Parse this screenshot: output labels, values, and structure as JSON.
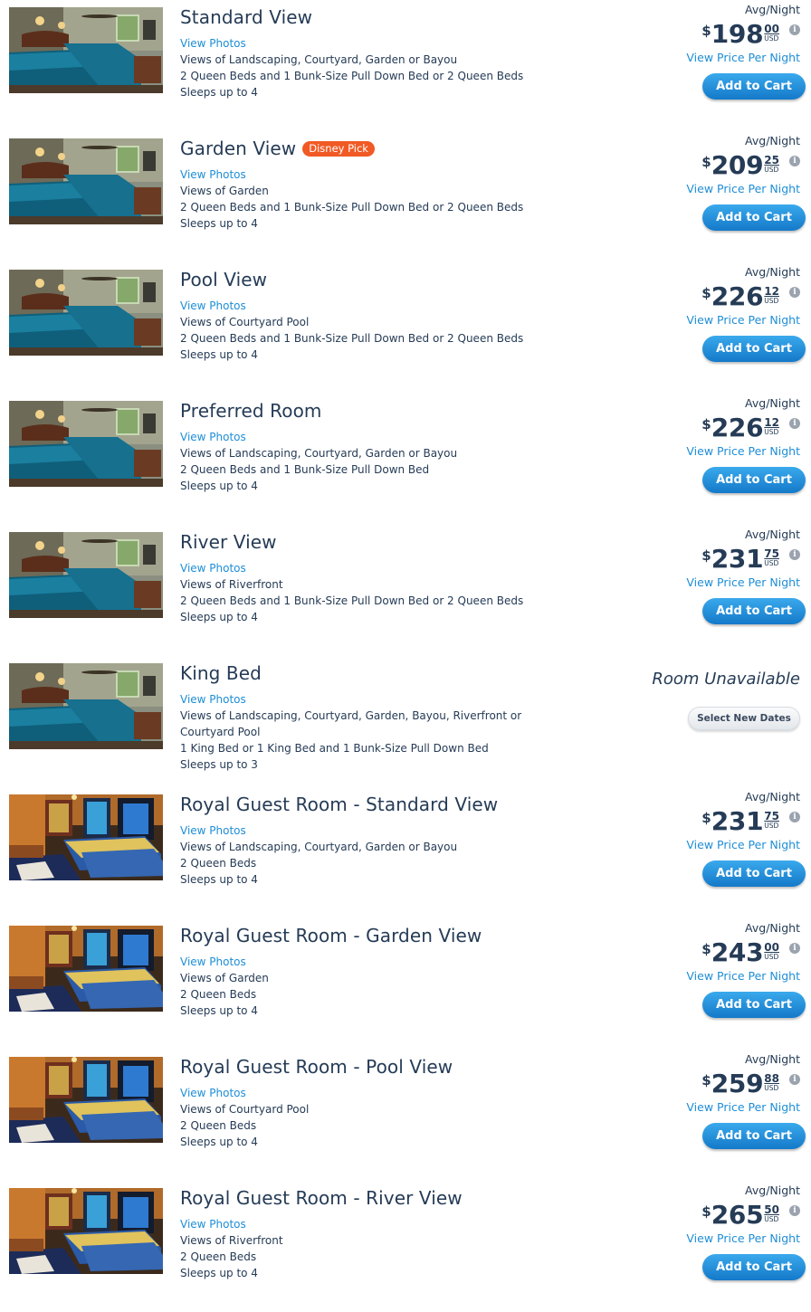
{
  "rooms": [
    {
      "title": "Standard View",
      "badge": "",
      "view_photos": "View Photos",
      "lines": [
        "Views of Landscaping, Courtyard, Garden or Bayou",
        "2 Queen Beds and 1 Bunk-Size Pull Down Bed or 2 Queen Beds",
        "Sleeps up to 4"
      ],
      "available": true,
      "avg_label": "Avg/Night",
      "currency_symbol": "$",
      "price_whole": "198",
      "price_cents": "00",
      "currency": "USD",
      "info_icon": "i",
      "price_per_night": "View Price Per Night",
      "add_to_cart": "Add to Cart",
      "image": "room-photo"
    },
    {
      "title": "Garden View",
      "badge": "Disney Pick",
      "view_photos": "View Photos",
      "lines": [
        "Views of Garden",
        "2 Queen Beds and 1 Bunk-Size Pull Down Bed or 2 Queen Beds",
        "Sleeps up to 4"
      ],
      "available": true,
      "avg_label": "Avg/Night",
      "currency_symbol": "$",
      "price_whole": "209",
      "price_cents": "25",
      "currency": "USD",
      "info_icon": "i",
      "price_per_night": "View Price Per Night",
      "add_to_cart": "Add to Cart",
      "image": "room-photo"
    },
    {
      "title": "Pool View",
      "badge": "",
      "view_photos": "View Photos",
      "lines": [
        "Views of Courtyard Pool",
        "2 Queen Beds and 1 Bunk-Size Pull Down Bed or 2 Queen Beds",
        "Sleeps up to 4"
      ],
      "available": true,
      "avg_label": "Avg/Night",
      "currency_symbol": "$",
      "price_whole": "226",
      "price_cents": "12",
      "currency": "USD",
      "info_icon": "i",
      "price_per_night": "View Price Per Night",
      "add_to_cart": "Add to Cart",
      "image": "room-photo"
    },
    {
      "title": "Preferred Room",
      "badge": "",
      "view_photos": "View Photos",
      "lines": [
        "Views of Landscaping, Courtyard, Garden or Bayou",
        "2 Queen Beds and 1 Bunk-Size Pull Down Bed",
        "Sleeps up to 4"
      ],
      "available": true,
      "avg_label": "Avg/Night",
      "currency_symbol": "$",
      "price_whole": "226",
      "price_cents": "12",
      "currency": "USD",
      "info_icon": "i",
      "price_per_night": "View Price Per Night",
      "add_to_cart": "Add to Cart",
      "image": "room-photo"
    },
    {
      "title": "River View",
      "badge": "",
      "view_photos": "View Photos",
      "lines": [
        "Views of Riverfront",
        "2 Queen Beds and 1 Bunk-Size Pull Down Bed or 2 Queen Beds",
        "Sleeps up to 4"
      ],
      "available": true,
      "avg_label": "Avg/Night",
      "currency_symbol": "$",
      "price_whole": "231",
      "price_cents": "75",
      "currency": "USD",
      "info_icon": "i",
      "price_per_night": "View Price Per Night",
      "add_to_cart": "Add to Cart",
      "image": "room-photo"
    },
    {
      "title": "King Bed",
      "badge": "",
      "view_photos": "View Photos",
      "lines": [
        "Views of Landscaping, Courtyard, Garden, Bayou, Riverfront or",
        "Courtyard Pool",
        "1 King Bed or 1 King Bed and 1 Bunk-Size Pull Down Bed",
        "Sleeps up to 3"
      ],
      "available": false,
      "unavailable_text": "Room Unavailable",
      "select_dates": "Select New Dates",
      "image": "room-photo"
    },
    {
      "title": "Royal Guest Room - Standard View",
      "badge": "",
      "view_photos": "View Photos",
      "lines": [
        "Views of Landscaping, Courtyard, Garden or Bayou",
        "2 Queen Beds",
        "Sleeps up to 4"
      ],
      "available": true,
      "avg_label": "Avg/Night",
      "currency_symbol": "$",
      "price_whole": "231",
      "price_cents": "75",
      "currency": "USD",
      "info_icon": "i",
      "price_per_night": "View Price Per Night",
      "add_to_cart": "Add to Cart",
      "image": "royal-photo"
    },
    {
      "title": "Royal Guest Room - Garden View",
      "badge": "",
      "view_photos": "View Photos",
      "lines": [
        "Views of Garden",
        "2 Queen Beds",
        "Sleeps up to 4"
      ],
      "available": true,
      "avg_label": "Avg/Night",
      "currency_symbol": "$",
      "price_whole": "243",
      "price_cents": "00",
      "currency": "USD",
      "info_icon": "i",
      "price_per_night": "View Price Per Night",
      "add_to_cart": "Add to Cart",
      "image": "royal-photo"
    },
    {
      "title": "Royal Guest Room - Pool View",
      "badge": "",
      "view_photos": "View Photos",
      "lines": [
        "Views of Courtyard Pool",
        "2 Queen Beds",
        "Sleeps up to 4"
      ],
      "available": true,
      "avg_label": "Avg/Night",
      "currency_symbol": "$",
      "price_whole": "259",
      "price_cents": "88",
      "currency": "USD",
      "info_icon": "i",
      "price_per_night": "View Price Per Night",
      "add_to_cart": "Add to Cart",
      "image": "royal-photo"
    },
    {
      "title": "Royal Guest Room - River View",
      "badge": "",
      "view_photos": "View Photos",
      "lines": [
        "Views of Riverfront",
        "2 Queen Beds",
        "Sleeps up to 4"
      ],
      "available": true,
      "avg_label": "Avg/Night",
      "currency_symbol": "$",
      "price_whole": "265",
      "price_cents": "50",
      "currency": "USD",
      "info_icon": "i",
      "price_per_night": "View Price Per Night",
      "add_to_cart": "Add to Cart",
      "image": "royal-photo"
    }
  ],
  "colors": {
    "text": "#253b56",
    "link": "#1e8ed6",
    "badge": "#f15a24",
    "button": "#1e8ed6"
  }
}
